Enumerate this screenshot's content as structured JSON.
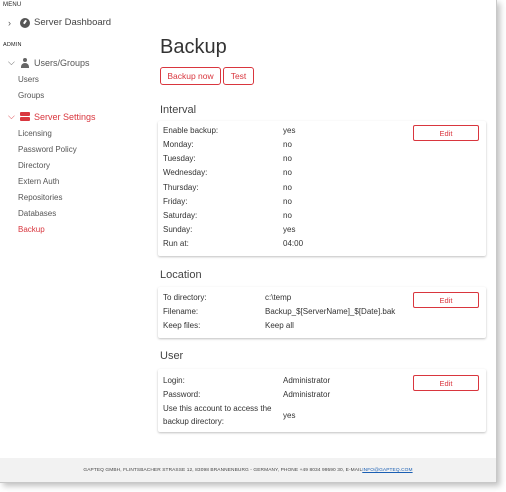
{
  "menu": {
    "label": "MENU",
    "dashboard": "Server Dashboard"
  },
  "admin": {
    "label": "ADMIN",
    "groups": [
      {
        "label": "Users/Groups",
        "items": [
          "Users",
          "Groups"
        ]
      },
      {
        "label": "Server Settings",
        "items": [
          "Licensing",
          "Password Policy",
          "Directory",
          "Extern Auth",
          "Repositories",
          "Databases",
          "Backup"
        ]
      }
    ],
    "active_item": "Backup"
  },
  "page": {
    "title": "Backup",
    "buttons": {
      "backup_now": "Backup now",
      "test": "Test"
    }
  },
  "interval": {
    "title": "Interval",
    "edit_label": "Edit",
    "rows": [
      {
        "label": "Enable backup:",
        "value": "yes"
      },
      {
        "label": "Monday:",
        "value": "no"
      },
      {
        "label": "Tuesday:",
        "value": "no"
      },
      {
        "label": "Wednesday:",
        "value": "no"
      },
      {
        "label": "Thursday:",
        "value": "no"
      },
      {
        "label": "Friday:",
        "value": "no"
      },
      {
        "label": "Saturday:",
        "value": "no"
      },
      {
        "label": "Sunday:",
        "value": "yes"
      },
      {
        "label": "Run at:",
        "value": "04:00"
      }
    ]
  },
  "location": {
    "title": "Location",
    "edit_label": "Edit",
    "rows": [
      {
        "label": "To directory:",
        "value": "c:\\temp"
      },
      {
        "label": "Filename:",
        "value": "Backup_$[ServerName]_$[Date].bak"
      },
      {
        "label": "Keep files:",
        "value": "Keep all"
      }
    ]
  },
  "user": {
    "title": "User",
    "edit_label": "Edit",
    "rows": [
      {
        "label": "Login:",
        "value": "Administrator"
      },
      {
        "label": "Password:",
        "value": "Administrator"
      },
      {
        "label_line1": "Use this account to access the",
        "label_line2": "backup directory:",
        "value": "yes"
      }
    ]
  },
  "footer": {
    "text": "GAPTEQ GMBH, FLINTSBACHER STRASSE 12, 83098 BRANNENBURG - GERMANY, PHONE +49 8034 99590 30, E-MAIL ",
    "email": "INFO@GAPTEQ.COM"
  },
  "colors": {
    "accent": "#d9363e",
    "link": "#1a5fb4"
  }
}
